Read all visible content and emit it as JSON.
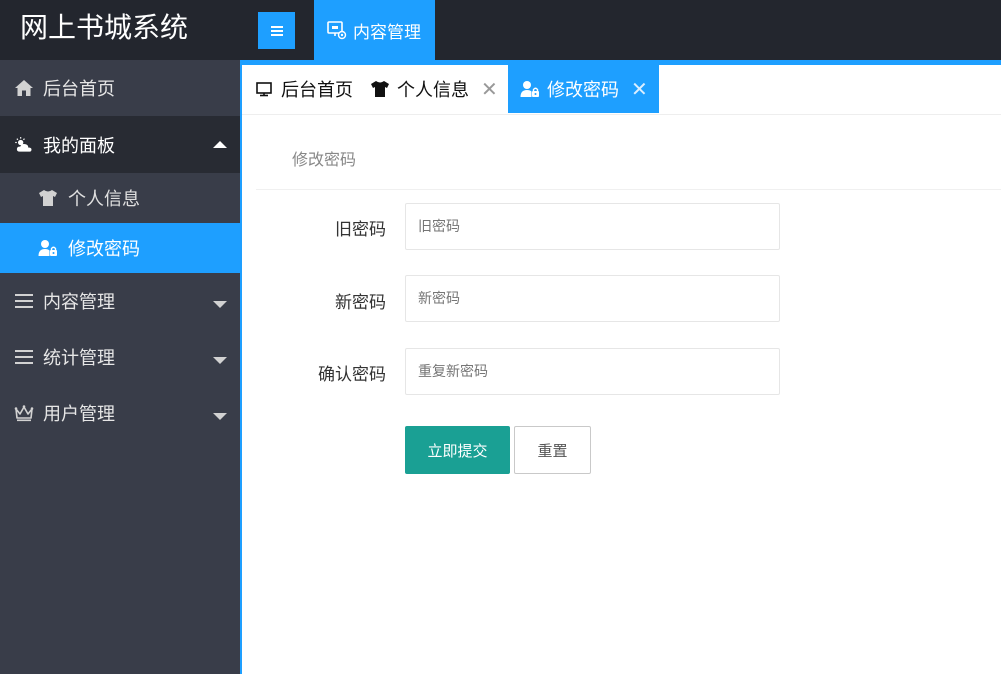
{
  "app": {
    "title": "网上书城系统"
  },
  "header": {
    "menu_toggle_icon": "menu-icon",
    "nav_label": "内容管理",
    "nav_icon": "content-manage-icon"
  },
  "sidebar": {
    "items": [
      {
        "label": "后台首页",
        "icon": "home-icon"
      },
      {
        "label": "我的面板",
        "icon": "weather-icon",
        "expanded": true,
        "children": [
          {
            "label": "个人信息",
            "icon": "tshirt-icon"
          },
          {
            "label": "修改密码",
            "icon": "user-lock-icon",
            "active": true
          }
        ]
      },
      {
        "label": "内容管理",
        "icon": "list-icon"
      },
      {
        "label": "统计管理",
        "icon": "list-icon"
      },
      {
        "label": "用户管理",
        "icon": "crown-icon"
      }
    ]
  },
  "tabs": [
    {
      "label": "后台首页",
      "icon": "monitor-icon",
      "closable": false
    },
    {
      "label": "个人信息",
      "icon": "tshirt-icon",
      "closable": true
    },
    {
      "label": "修改密码",
      "icon": "user-lock-icon",
      "closable": true,
      "active": true
    }
  ],
  "tab_close_symbol": "✕",
  "form": {
    "title": "修改密码",
    "fields": [
      {
        "label": "旧密码",
        "placeholder": "旧密码",
        "value": ""
      },
      {
        "label": "新密码",
        "placeholder": "新密码",
        "value": ""
      },
      {
        "label": "确认密码",
        "placeholder": "重复新密码",
        "value": ""
      }
    ],
    "submit_label": "立即提交",
    "reset_label": "重置"
  },
  "colors": {
    "header_bg": "#23262e",
    "sidebar_bg": "#393d49",
    "accent": "#1e9fff",
    "submit": "#1aa094"
  }
}
